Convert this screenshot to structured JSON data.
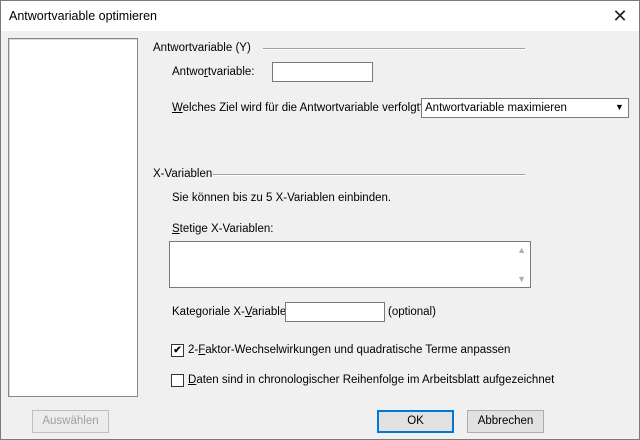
{
  "window": {
    "title": "Antwortvariable optimieren"
  },
  "response_group": {
    "header": "Antwortvariable (Y)",
    "response_label_pre": "Antwo",
    "response_label_u": "r",
    "response_label_post": "tvariable:",
    "response_value": "",
    "goal_label_u": "W",
    "goal_label_post": "elches Ziel wird für die Antwortvariable verfolgt?",
    "goal_selected": "Antwortvariable maximieren"
  },
  "x_group": {
    "header": "X-Variablen",
    "info": "Sie können bis zu 5 X-Variablen einbinden.",
    "continuous_label_u": "S",
    "continuous_label_post": "tetige X-Variablen:",
    "categorical_label_pre": "Kategoriale X-",
    "categorical_label_u": "V",
    "categorical_label_post": "ariable:",
    "categorical_value": "",
    "optional": "(optional)",
    "check1_pre": "2-",
    "check1_u": "F",
    "check1_post": "aktor-Wechselwirkungen und quadratische Terme anpassen",
    "check1_checked": "✔",
    "check2_u": "D",
    "check2_post": "aten sind in chronologischer Reihenfolge im Arbeitsblatt aufgezeichnet"
  },
  "buttons": {
    "select": "Auswählen",
    "ok": "OK",
    "cancel": "Abbrechen"
  }
}
